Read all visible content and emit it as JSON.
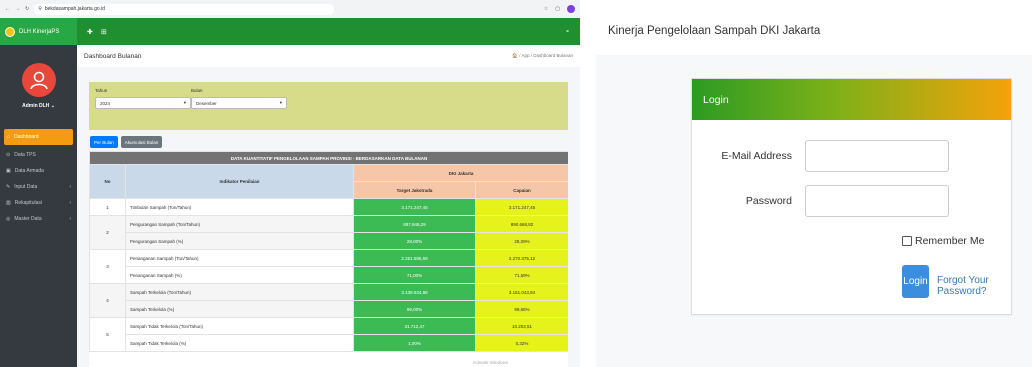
{
  "browser": {
    "url": "bekdasampah.jakarta.go.id"
  },
  "sidebar": {
    "brand": "DLH KinerjaPS",
    "user_name": "Admin DLH",
    "items": [
      {
        "label": "Dashboard",
        "active": true
      },
      {
        "label": "Data TPS"
      },
      {
        "label": "Data Armada"
      },
      {
        "label": "Input Data"
      },
      {
        "label": "Rekapitulasi"
      },
      {
        "label": "Master Data"
      }
    ]
  },
  "header": {
    "title": "Dashboard Bulanan",
    "breadcrumb": "🏠 / App / Dashboard Bulanan"
  },
  "filter": {
    "tahun_label": "Tahun",
    "tahun_value": "2024",
    "bulan_label": "Bulan",
    "bulan_value": "Desember"
  },
  "buttons": {
    "per_bulan": "Per Bulan",
    "akumulasi": "Akumulasi Bulan"
  },
  "table": {
    "caption": "DATA KUANTITATIF PENGELOLAAN SAMPAH PROVINSI - BERDASARKAN DATA BULANAN",
    "col_no": "No",
    "col_indikator": "Indikator Penilaian",
    "col_group": "DKI Jakarta",
    "col_target": "Target Jakstrada",
    "col_capaian": "Capaian",
    "rows": [
      {
        "no": "1",
        "items": [
          {
            "indikator": "Timbulan Sampah (Ton/Tahun)",
            "target": "3.171.247,45",
            "capaian": "3.171.247,45"
          }
        ]
      },
      {
        "no": "2",
        "items": [
          {
            "indikator": "Pengurangan Sampah (Ton/Tahun)",
            "target": "887.949,29",
            "capaian": "890.668,82"
          },
          {
            "indikator": "Pengurangan Sampah (%)",
            "target": "28,00%",
            "capaian": "28,09%"
          }
        ]
      },
      {
        "no": "3",
        "items": [
          {
            "indikator": "Penanganan Sampah (Ton/Tahun)",
            "target": "2.251.585,69",
            "capaian": "2.270.375,12"
          },
          {
            "indikator": "Penanganan Sampah (%)",
            "target": "71,00%",
            "capaian": "71,59%"
          }
        ]
      },
      {
        "no": "4",
        "items": [
          {
            "indikator": "Sampah Terkelola (Ton/Tahun)",
            "target": "3.139.534,98",
            "capaian": "3.161.043,94"
          },
          {
            "indikator": "Sampah Terkelola (%)",
            "target": "99,00%",
            "capaian": "99,68%"
          }
        ]
      },
      {
        "no": "5",
        "items": [
          {
            "indikator": "Sampah Tidak Terkelola (Ton/Tahun)",
            "target": "31.712,47",
            "capaian": "10.203,51"
          },
          {
            "indikator": "Sampah Tidak Terkelola (%)",
            "target": "1,00%",
            "capaian": "0,32%"
          }
        ]
      }
    ]
  },
  "watermark": "Activate Windows",
  "login": {
    "app_title": "Kinerja Pengelolaan Sampah DKI Jakarta",
    "card_title": "Login",
    "email_label": "E-Mail Address",
    "password_label": "Password",
    "remember_label": "Remember Me",
    "login_button": "Login",
    "forgot_link": "Forgot Your Password?"
  }
}
